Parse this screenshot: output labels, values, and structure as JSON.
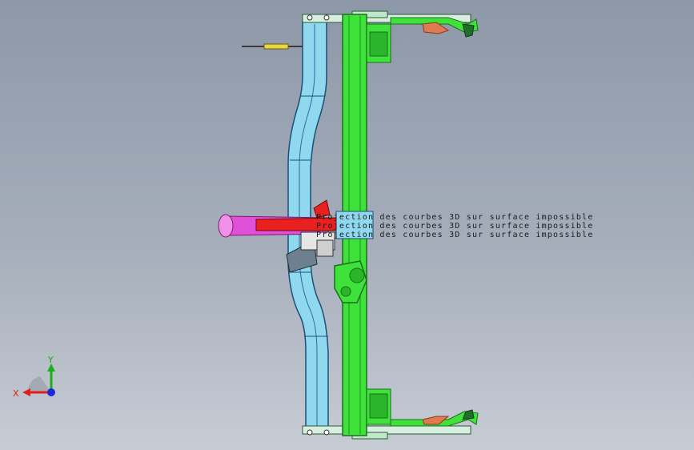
{
  "viewport": {
    "background_top": "#8d98a8",
    "background_bottom": "#c7ccd4"
  },
  "warnings": [
    "Projection des courbes 3D sur surface impossible",
    "Projection des courbes 3D sur surface impossible",
    "Projection des courbes 3D sur surface impossible"
  ],
  "triad": {
    "x_label": "X",
    "y_label": "Y",
    "x_color": "#e0201a",
    "y_color": "#18b018",
    "z_color": "#1a2ad8"
  },
  "colors": {
    "main_beam": "#3ee23a",
    "blue_frame": "#8fd8ee",
    "magenta_pipe": "#e050d8",
    "red_arm": "#e82020",
    "orange_bracket": "#e07a50"
  }
}
